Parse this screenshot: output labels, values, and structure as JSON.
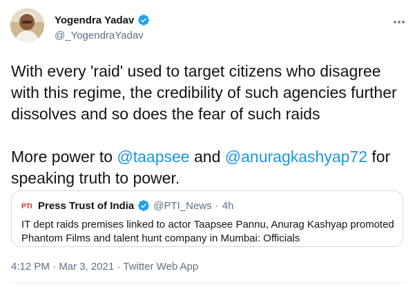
{
  "author": {
    "display_name": "Yogendra Yadav",
    "handle": "@_YogendraYadav",
    "verified": true
  },
  "more_icon": "more-horizontal-icon",
  "tweet": {
    "paragraph1": "With every 'raid' used to target citizens who disagree with this regime, the credibility of such agencies further dissolves and so does the fear of such raids",
    "p2_prefix": "More power to ",
    "mention1": "@taapsee",
    "p2_mid": " and ",
    "mention2": "@anuragkashyap72",
    "p2_suffix": " for speaking truth to power."
  },
  "quoted_tweet": {
    "display_name": "Press Trust of India",
    "handle": "@PTI_News",
    "separator": "·",
    "time": "4h",
    "text": "IT dept raids premises linked to actor Taapsee Pannu, Anurag Kashyap promoted Phantom Films and talent hunt company in Mumbai: Officials",
    "logo_text": "PTI"
  },
  "meta": {
    "line": "4:12 PM · Mar 3, 2021 · Twitter Web App"
  },
  "colors": {
    "accent": "#1b95e0",
    "secondary_text": "#5b7083",
    "verified_badge": "#1da1f2",
    "pti_red": "#e02020"
  }
}
